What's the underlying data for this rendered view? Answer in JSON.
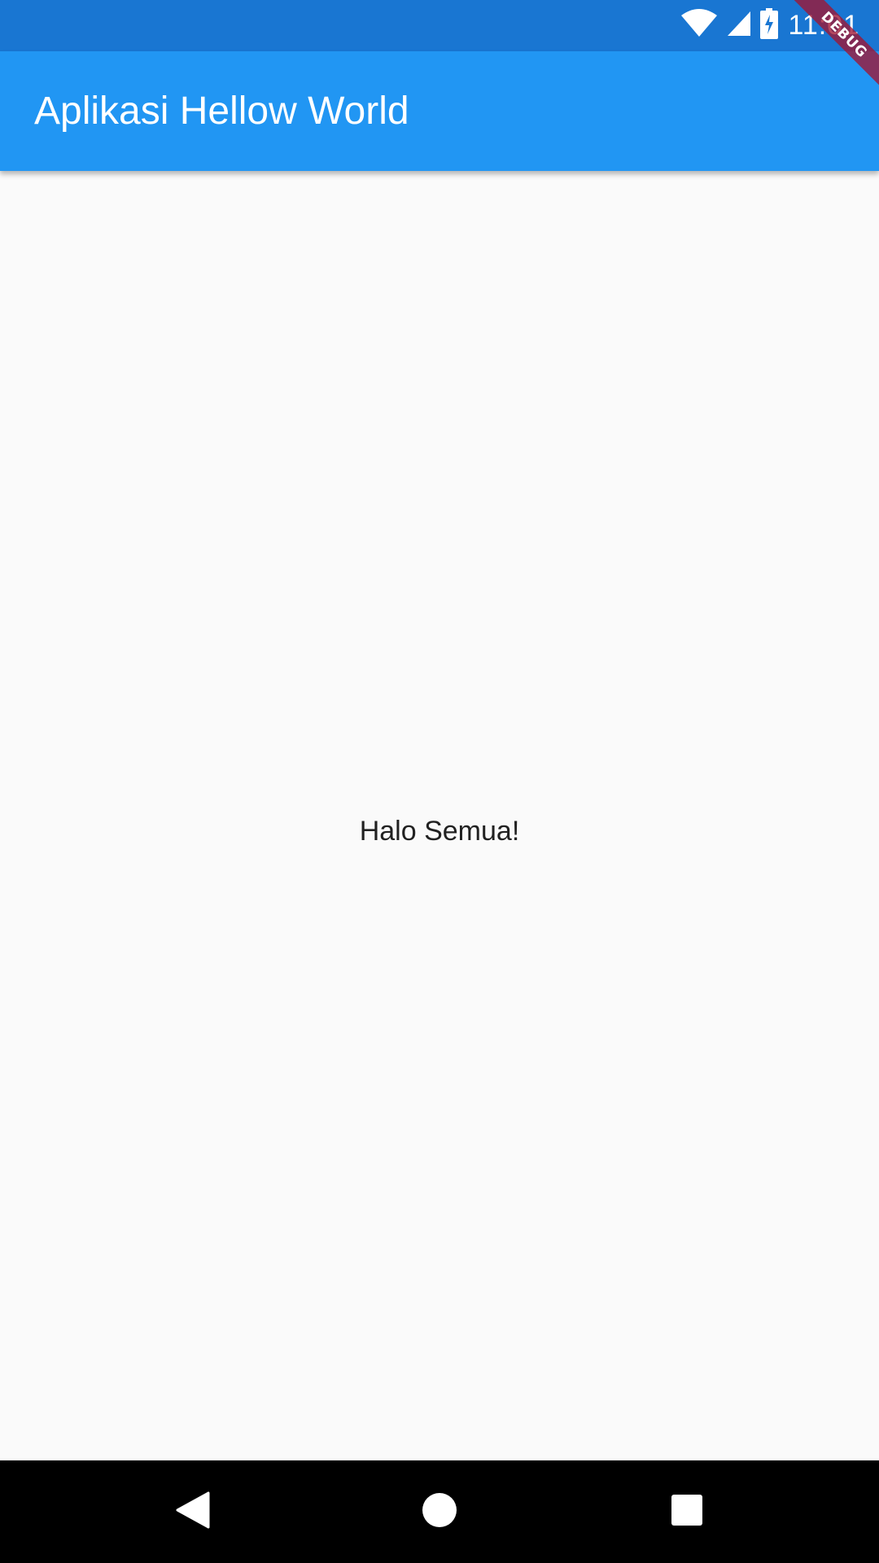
{
  "status_bar": {
    "time": "11:01",
    "icons": [
      "wifi-icon",
      "signal-icon",
      "battery-charging-icon"
    ],
    "color": "#1976d2"
  },
  "app_bar": {
    "title": "Aplikasi Hellow World",
    "color": "#2196f3"
  },
  "body": {
    "text": "Halo Semua!"
  },
  "debug_banner": {
    "label": "DEBUG"
  },
  "nav_bar": {
    "buttons": [
      "back-icon",
      "home-icon",
      "recents-icon"
    ]
  }
}
